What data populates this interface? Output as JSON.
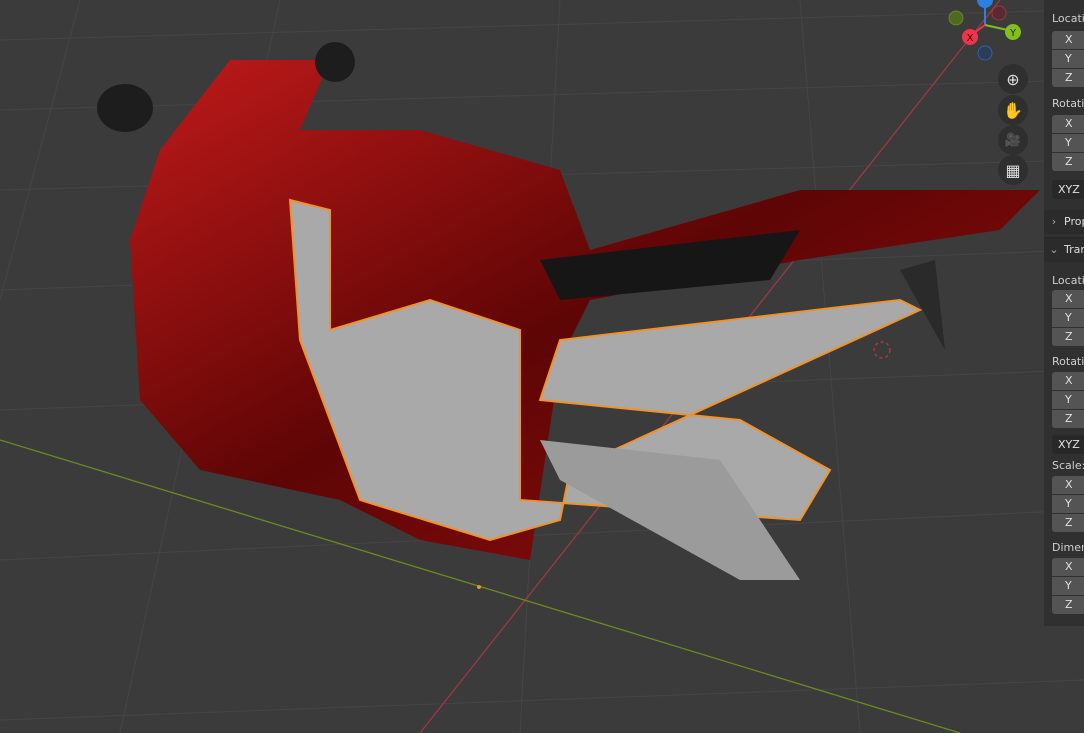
{
  "gizmo": {
    "axes": [
      "X",
      "Y",
      "Z"
    ],
    "colors": {
      "x": "#f0334f",
      "y": "#7fbf1f",
      "z": "#2f7fe0"
    }
  },
  "nav_buttons": [
    {
      "name": "zoom",
      "icon": "magnifier-plus-icon",
      "glyph": "⊕"
    },
    {
      "name": "pan",
      "icon": "hand-icon",
      "glyph": "✋"
    },
    {
      "name": "camera",
      "icon": "camera-icon",
      "glyph": "🎥"
    },
    {
      "name": "perspective",
      "icon": "grid-icon",
      "glyph": "▦"
    }
  ],
  "panel": {
    "top": {
      "location_label": "Location",
      "rotation_label": "Rotation",
      "axes": [
        "X",
        "Y",
        "Z"
      ],
      "rotation_mode": "XYZ Euler"
    },
    "properties_header": "Properties",
    "transform_header": "Transform",
    "transform": {
      "location_label": "Location",
      "rotation_label": "Rotation",
      "rotation_mode": "XYZ Euler",
      "scale_label": "Scale:",
      "dimensions_label": "Dimensions:",
      "axes": [
        "X",
        "Y",
        "Z"
      ]
    }
  },
  "colors": {
    "selection_outline": "#f0922a",
    "bike_red": "#8a0c0c",
    "frame_gray": "#a8a8a8"
  }
}
